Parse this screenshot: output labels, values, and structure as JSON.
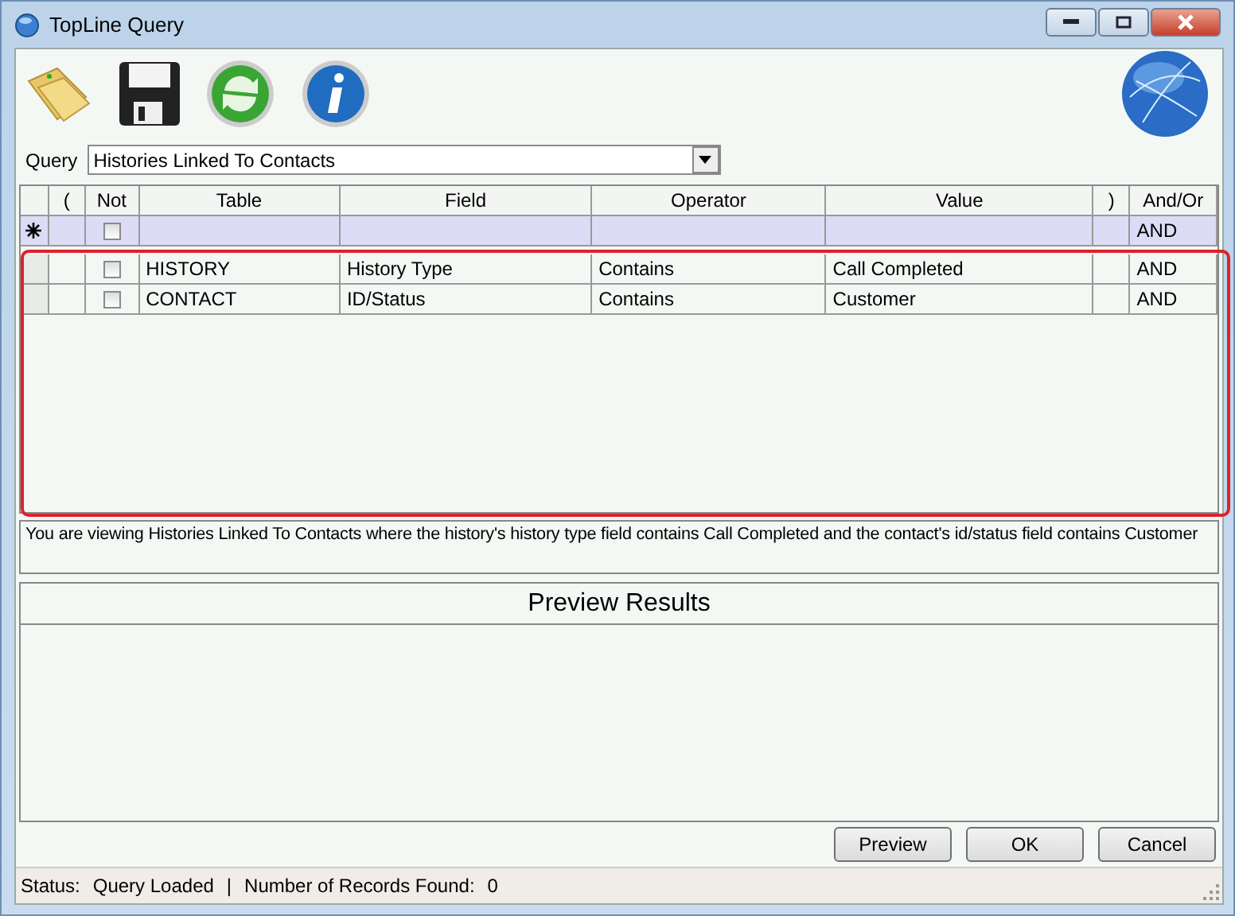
{
  "window": {
    "title": "TopLine Query"
  },
  "query": {
    "label": "Query",
    "value": "Histories Linked To Contacts"
  },
  "grid": {
    "columns": [
      "(",
      "Not",
      "Table",
      "Field",
      "Operator",
      "Value",
      ")",
      "And/Or"
    ],
    "new_row": {
      "not": false,
      "and_or": "AND"
    },
    "rows": [
      {
        "open": "",
        "not": false,
        "table": "HISTORY",
        "field": "History Type",
        "operator": "Contains",
        "value": "Call Completed",
        "close": "",
        "and_or": "AND"
      },
      {
        "open": "",
        "not": false,
        "table": "CONTACT",
        "field": "ID/Status",
        "operator": "Contains",
        "value": "Customer",
        "close": "",
        "and_or": "AND"
      }
    ]
  },
  "description": "You are viewing Histories Linked To Contacts where the history's history type field contains Call Completed and the contact's id/status field contains Customer",
  "preview": {
    "title": "Preview Results"
  },
  "buttons": [
    "Preview",
    "OK",
    "Cancel"
  ],
  "status_bar": {
    "status_label": "Status:",
    "status": "Query Loaded",
    "separator": "|",
    "records_label": "Number of Records Found:",
    "records": "0"
  }
}
